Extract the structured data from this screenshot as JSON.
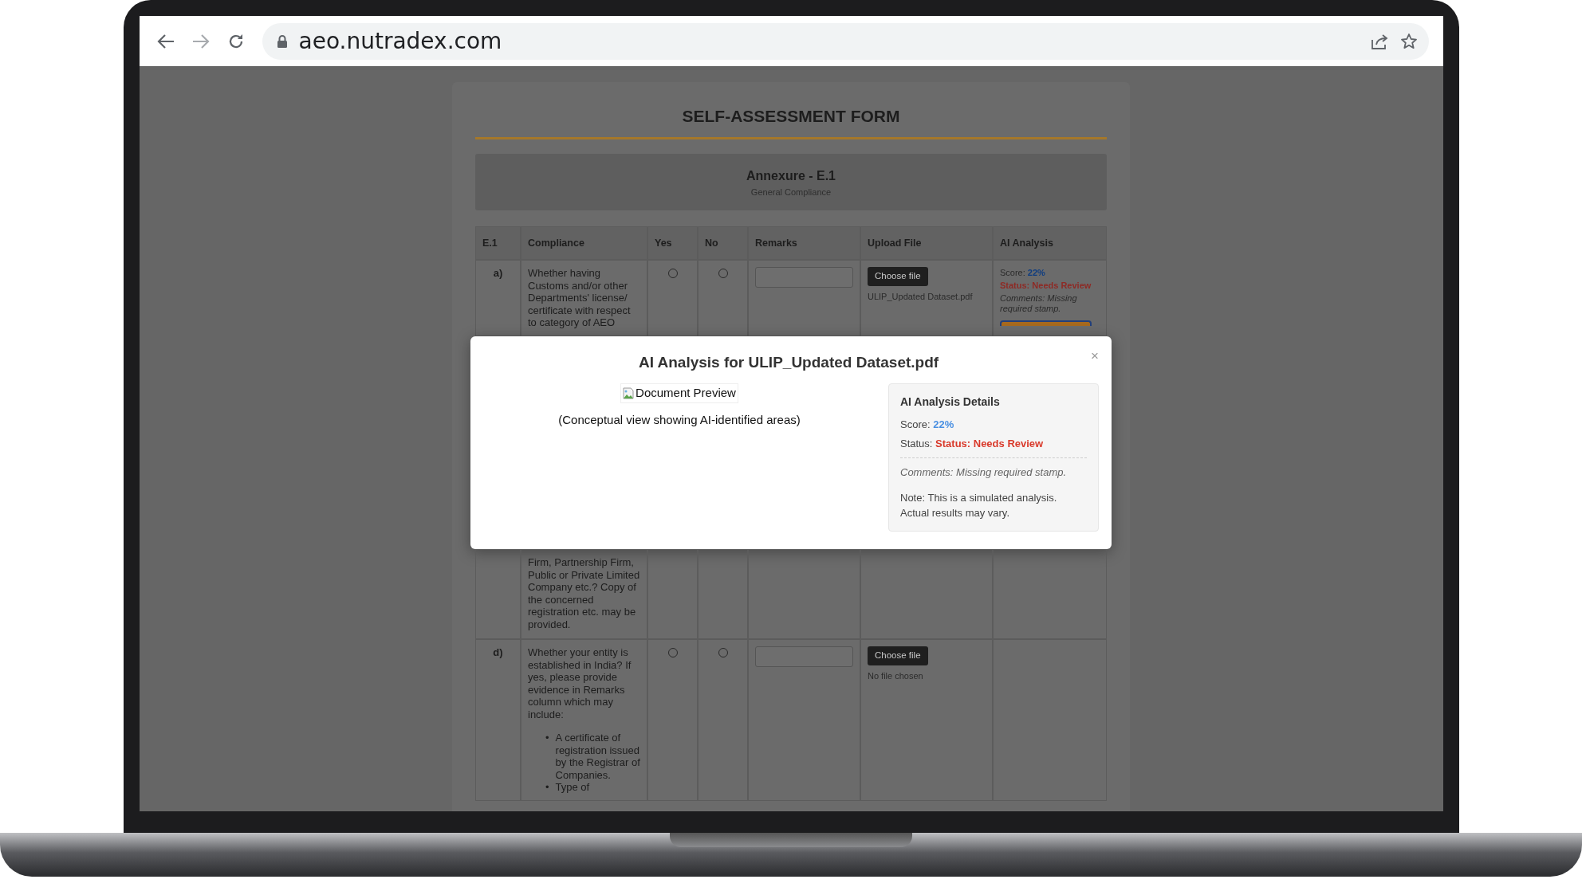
{
  "browser": {
    "url": "aeo.nutradex.com"
  },
  "form": {
    "title": "SELF-ASSESSMENT FORM",
    "annexure": {
      "title": "Annexure - E.1",
      "subtitle": "General Compliance"
    },
    "columns": [
      "E.1",
      "Compliance",
      "Yes",
      "No",
      "Remarks",
      "Upload File",
      "AI Analysis"
    ],
    "rows_before": [
      {
        "kind": "full",
        "label": "a)",
        "text": "Whether having Customs and/or other Departments' license/ certificate with respect to category of AEO",
        "yes_selected": false,
        "no_selected": false,
        "upload_button": "Choose file",
        "file_status": "ULIP_Updated Dataset.pdf",
        "analysis": {
          "score_label": "Score:",
          "score": "22%",
          "status": "Status: Needs Review",
          "comments": "Comments: Missing required stamp."
        }
      }
    ],
    "rows_after": [
      {
        "kind": "continued",
        "text": "Firm, Partnership Firm, Public or Private Limited Company etc.? Copy of the concerned registration etc. may be provided."
      },
      {
        "kind": "full",
        "label": "d)",
        "text": "Whether your entity is established in India? If yes, please provide evidence in Remarks column which may include:",
        "bullets": [
          {
            "marker": "•",
            "text": "A certificate of registration issued by the Registrar of Companies."
          },
          {
            "marker": "•",
            "text": "Type of"
          }
        ],
        "yes_selected": false,
        "no_selected": false,
        "upload_button": "Choose file",
        "file_status": "No file chosen"
      }
    ]
  },
  "modal": {
    "title": "AI Analysis for ULIP_Updated Dataset.pdf",
    "close": "×",
    "preview_alt": "Document Preview",
    "caption": "(Conceptual view showing AI-identified areas)",
    "details": {
      "heading": "AI Analysis Details",
      "score_label": "Score:",
      "score": "22%",
      "status_label": "Status:",
      "status": "Status: Needs Review",
      "comments": "Comments: Missing required stamp.",
      "note": "Note: This is a simulated analysis. Actual results may vary."
    }
  }
}
